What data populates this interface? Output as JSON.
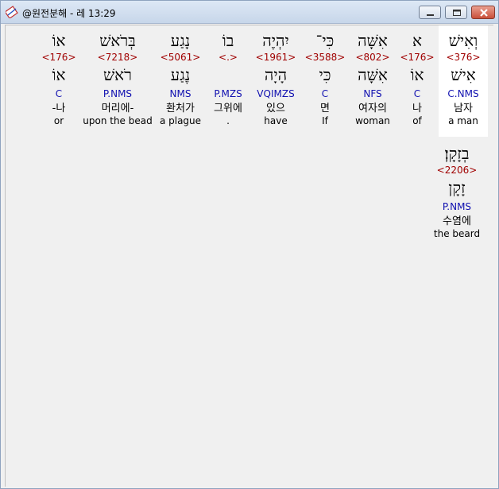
{
  "window": {
    "title": "@원전분해 - 레 13:29"
  },
  "colors": {
    "strong": "#a00000",
    "morph": "#1010b0",
    "highlight": "#ffffff"
  },
  "words": [
    {
      "heb": "וְאִישׁ",
      "strong": "<376>",
      "lemma": "אִישׁ",
      "morph": "C.NMS",
      "kor": "남자",
      "eng": "a man",
      "highlight": true
    },
    {
      "heb": "א",
      "strong": "<176>",
      "lemma": "אוֹ",
      "morph": "C",
      "kor": "나",
      "eng": "of"
    },
    {
      "heb": "אִשָּׁה",
      "strong": "<802>",
      "lemma": "אִשָּׁה",
      "morph": "NFS",
      "kor": "여자의",
      "eng": "woman"
    },
    {
      "heb": "כִּי־",
      "strong": "<3588>",
      "lemma": "כִּי",
      "morph": "C",
      "kor": "면",
      "eng": "If"
    },
    {
      "heb": "יִהְיֶה",
      "strong": "<1961>",
      "lemma": "הָיָה",
      "morph": "VQIMZS",
      "kor": "있으",
      "eng": "have"
    },
    {
      "heb": "בוֹ",
      "strong": "<.>",
      "lemma": "",
      "morph": "P.MZS",
      "kor": "그위에",
      "eng": "."
    },
    {
      "heb": "נָגַע",
      "strong": "<5061>",
      "lemma": "נֶגַע",
      "morph": "NMS",
      "kor": "환처가",
      "eng": "a plague"
    },
    {
      "heb": "בְּרֹאשׁ",
      "strong": "<7218>",
      "lemma": "רֹאשׁ",
      "morph": "P.NMS",
      "kor": "머리에-",
      "eng": "upon the bead"
    },
    {
      "heb": "אוֹ",
      "strong": "<176>",
      "lemma": "אוֹ",
      "morph": "C",
      "kor": "-나",
      "eng": "or"
    },
    {
      "heb": "בְזָקָן׃",
      "strong": "<2206>",
      "lemma": "זָקָן",
      "morph": "P.NMS",
      "kor": "수염에",
      "eng": "the beard"
    }
  ]
}
